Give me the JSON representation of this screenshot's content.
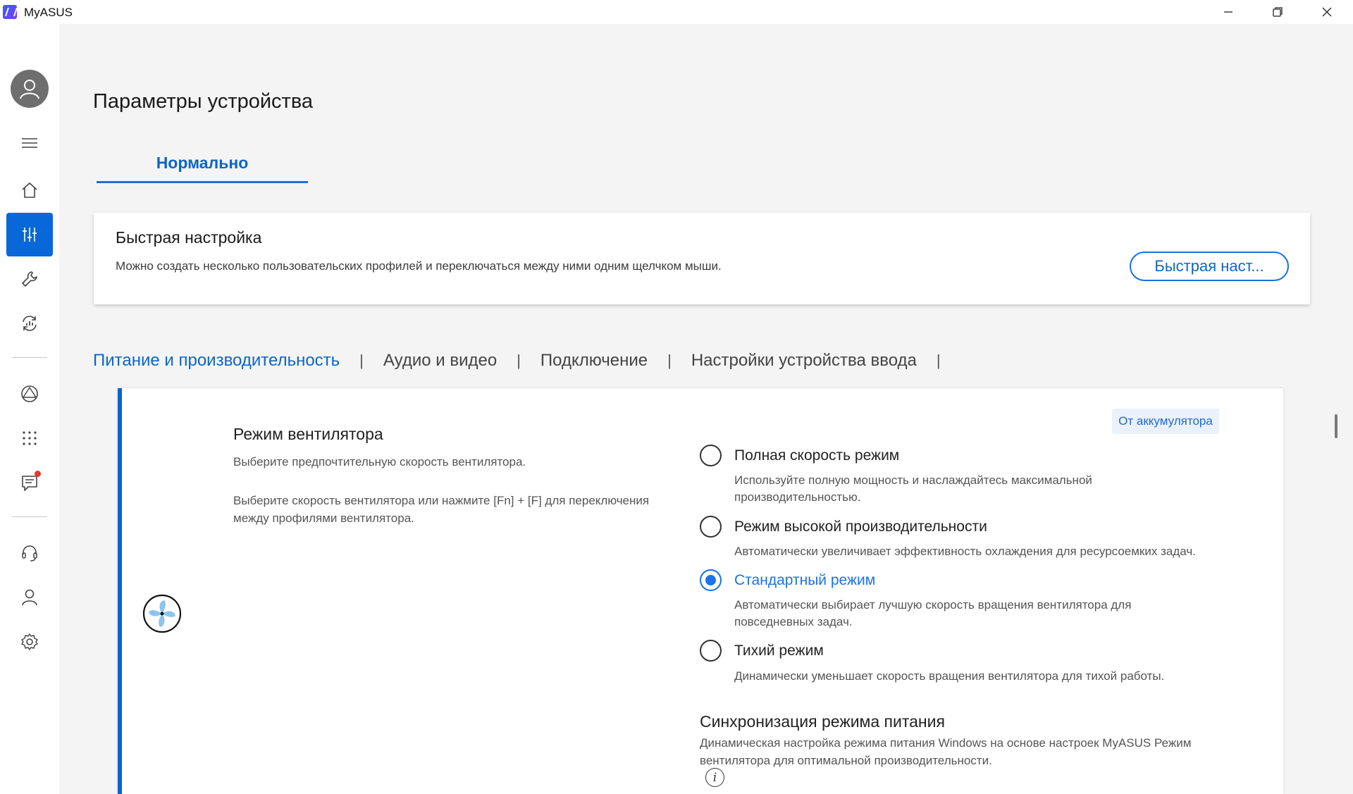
{
  "window": {
    "title": "MyASUS"
  },
  "sidebar": {
    "items": [
      {
        "name": "menu",
        "icon": "hamburger-icon"
      },
      {
        "name": "home",
        "icon": "home-icon"
      },
      {
        "name": "device-settings",
        "icon": "sliders-icon",
        "active": true
      },
      {
        "name": "system-diagnosis",
        "icon": "wrench-icon"
      },
      {
        "name": "system-update",
        "icon": "sync-icon"
      },
      {
        "name": "link-to-myasus",
        "icon": "triangle-circle-icon"
      },
      {
        "name": "app-deals",
        "icon": "grid-dots-icon"
      },
      {
        "name": "news",
        "icon": "message-icon",
        "notification": true
      },
      {
        "name": "support",
        "icon": "headset-icon"
      },
      {
        "name": "account",
        "icon": "user-icon"
      },
      {
        "name": "settings",
        "icon": "gear-icon"
      }
    ]
  },
  "page": {
    "title": "Параметры устройства",
    "profile_tab": "Нормально"
  },
  "quick_settings": {
    "title": "Быстрая настройка",
    "description": "Можно создать несколько пользовательских профилей и переключаться между ними одним щелчком мыши.",
    "button_label": "Быстрая наст..."
  },
  "category_tabs": [
    {
      "label": "Питание и производительность",
      "active": true
    },
    {
      "label": "Аудио и видео",
      "active": false
    },
    {
      "label": "Подключение",
      "active": false
    },
    {
      "label": "Настройки устройства ввода",
      "active": false
    }
  ],
  "fan_mode": {
    "title": "Режим вентилятора",
    "description": "Выберите предпочтительную скорость вентилятора.",
    "hint": "Выберите скорость вентилятора или нажмите [Fn] + [F] для переключения между профилями вентилятора.",
    "power_source_badge": "От аккумулятора",
    "options": [
      {
        "label": "Полная скорость режим",
        "description": "Используйте полную мощность и наслаждайтесь максимальной производительностью.",
        "selected": false
      },
      {
        "label": "Режим высокой производительности",
        "description": "Автоматически увеличивает эффективность охлаждения для ресурсоемких задач.",
        "selected": false
      },
      {
        "label": "Стандартный режим",
        "description": "Автоматически выбирает лучшую скорость вращения вентилятора для повседневных задач.",
        "selected": true
      },
      {
        "label": "Тихий режим",
        "description": "Динамически уменьшает скорость вращения вентилятора для тихой работы.",
        "selected": false
      }
    ]
  },
  "power_sync": {
    "title": "Синхронизация режима питания",
    "description": "Динамическая настройка режима питания Windows на основе настроек MyASUS Режим вентилятора для оптимальной производительности."
  },
  "colors": {
    "accent": "#0c66c6",
    "active_nav": "#0868d9",
    "radio_selected": "#1a73e8",
    "notification": "#e23a2a"
  }
}
